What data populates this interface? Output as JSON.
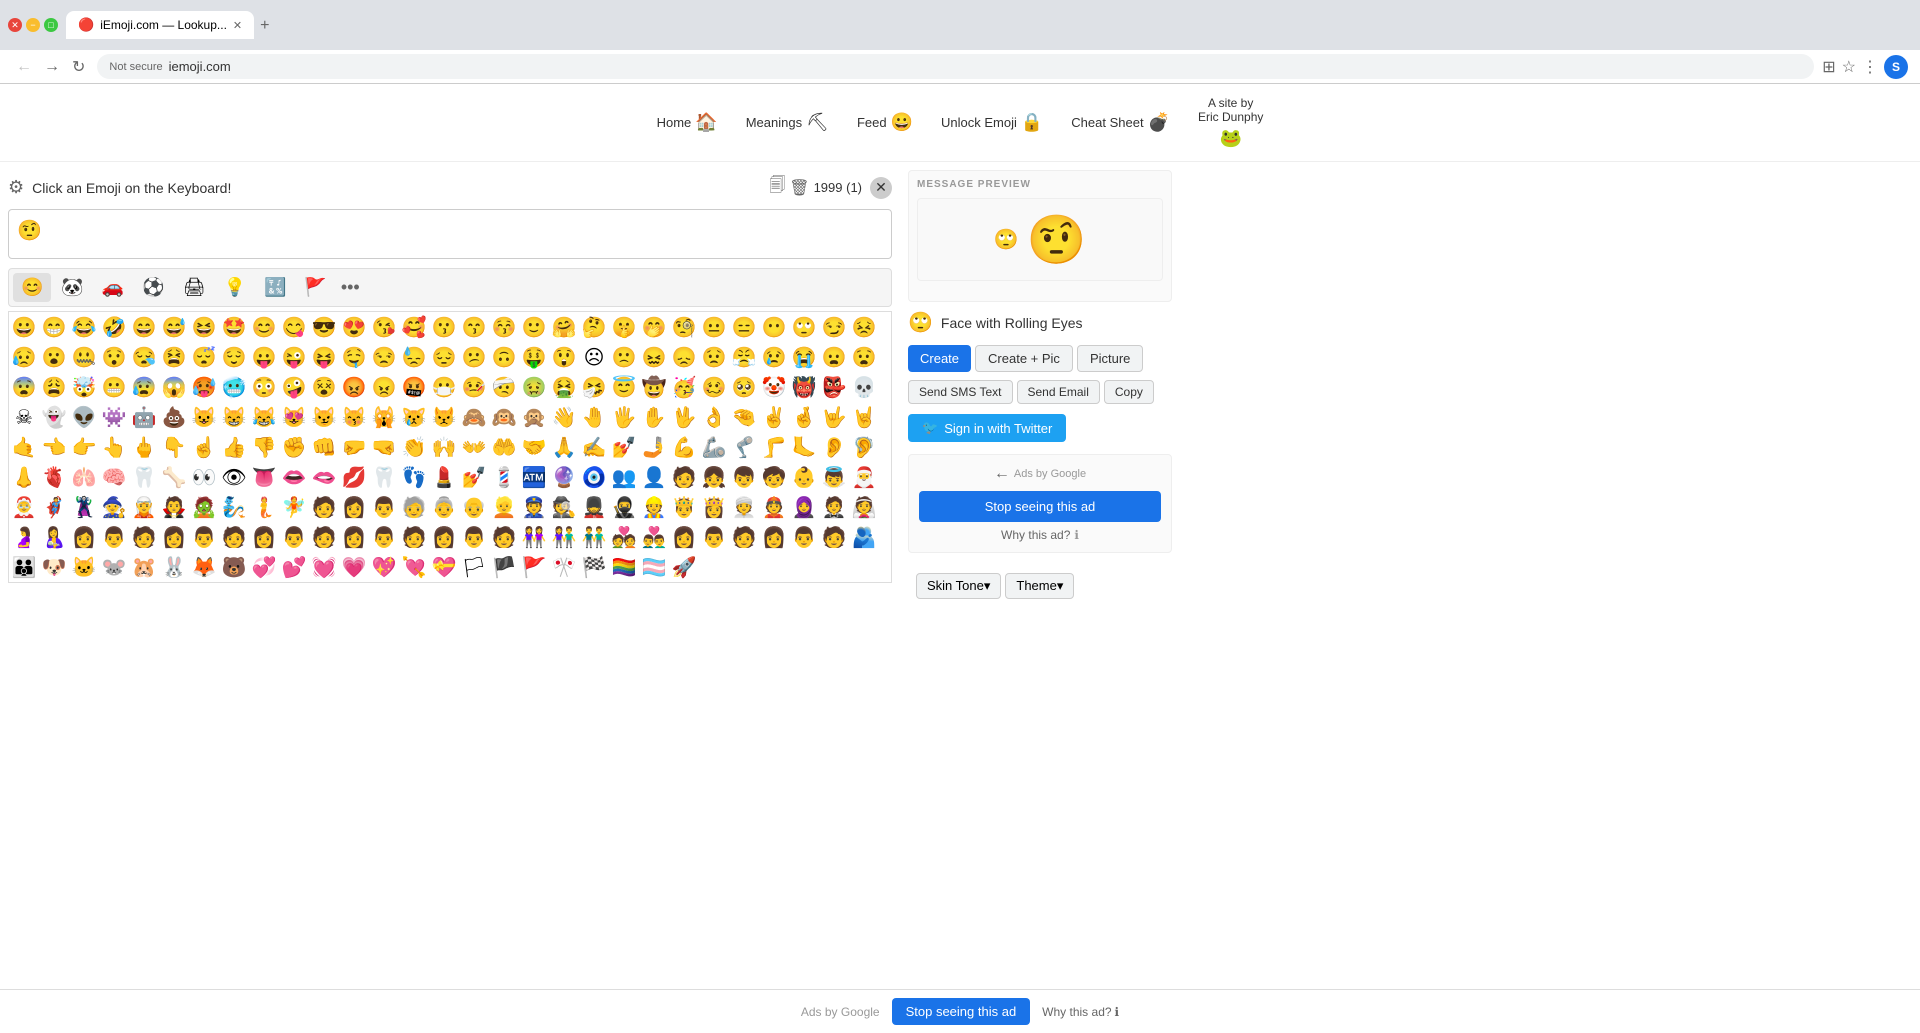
{
  "browser": {
    "tab_title": "iEmoji.com — Lookup...",
    "tab_favicon": "🔴",
    "url_security": "Not secure",
    "url": "iemoji.com",
    "new_tab_label": "+",
    "user_initial": "S"
  },
  "nav": {
    "items": [
      {
        "label": "Home",
        "emoji": "🏠"
      },
      {
        "label": "Meanings",
        "emoji": "⛏"
      },
      {
        "label": "Feed",
        "emoji": "😀"
      },
      {
        "label": "Unlock Emoji",
        "emoji": "🔒"
      },
      {
        "label": "Cheat Sheet",
        "emoji": "💣"
      }
    ],
    "site_by": "A site by\nEric Dunphy",
    "site_emoji": "🐸"
  },
  "keyboard": {
    "title": "Click an Emoji on the Keyboard!",
    "counter": "1999 (1)",
    "current_emoji": "🤨",
    "categories": [
      "😊",
      "🐼",
      "🚗",
      "⚽",
      "🖨",
      "💡",
      "🔣",
      "🚩",
      "•••"
    ]
  },
  "emojis": [
    "😀",
    "😁",
    "😂",
    "🤣",
    "😄",
    "😅",
    "😆",
    "🤩",
    "😊",
    "😋",
    "😎",
    "😍",
    "😘",
    "🥰",
    "😗",
    "😙",
    "😚",
    "🙂",
    "🤗",
    "🤔",
    "🤫",
    "🤭",
    "🧐",
    "😐",
    "😑",
    "😶",
    "🙄",
    "😏",
    "😣",
    "😥",
    "😮",
    "🤐",
    "😯",
    "😪",
    "😫",
    "😴",
    "😌",
    "😛",
    "😜",
    "😝",
    "🤤",
    "😒",
    "😓",
    "😔",
    "😕",
    "🙃",
    "🤑",
    "😲",
    "☹",
    "🙁",
    "😖",
    "😞",
    "😟",
    "😤",
    "😢",
    "😭",
    "😦",
    "😧",
    "😨",
    "😩",
    "🤯",
    "😬",
    "😰",
    "😱",
    "🥵",
    "🥶",
    "😳",
    "🤪",
    "😵",
    "😡",
    "😠",
    "🤬",
    "😷",
    "🤒",
    "🤕",
    "🤢",
    "🤮",
    "🤧",
    "😇",
    "🤠",
    "🥳",
    "🥴",
    "🥺",
    "🤡",
    "👹",
    "👺",
    "💀",
    "☠",
    "👻",
    "👽",
    "👾",
    "🤖",
    "💩",
    "😺",
    "😸",
    "😹",
    "😻",
    "😼",
    "😽",
    "🙀",
    "😿",
    "😾",
    "🙈",
    "🙉",
    "🙊",
    "👋",
    "🤚",
    "🖐",
    "✋",
    "🖖",
    "👌",
    "🤏",
    "✌",
    "🤞",
    "🤟",
    "🤘",
    "🤙",
    "👈",
    "👉",
    "👆",
    "🖕",
    "👇",
    "☝",
    "👍",
    "👎",
    "✊",
    "👊",
    "🤛",
    "🤜",
    "👏",
    "🙌",
    "👐",
    "🤲",
    "🤝",
    "🙏",
    "✍",
    "💅",
    "🤳",
    "💪",
    "🦾",
    "🦿",
    "🦵",
    "🦶",
    "👂",
    "🦻",
    "👃",
    "🫀",
    "🫁",
    "🧠",
    "🦷",
    "🦴",
    "👀",
    "👁",
    "👅",
    "👄",
    "🫦",
    "💋",
    "🦷",
    "👣",
    "💄",
    "💅",
    "💈",
    "🏧",
    "🔮",
    "🧿",
    "👥",
    "👤",
    "🧑",
    "👧",
    "👦",
    "🧒",
    "👶",
    "👼",
    "🎅",
    "🤶",
    "🦸",
    "🦹",
    "🧙",
    "🧝",
    "🧛",
    "🧟",
    "🧞",
    "🧜",
    "🧚",
    "🧑",
    "👩",
    "👨",
    "🧓",
    "👵",
    "👴",
    "👱",
    "👮",
    "🕵",
    "💂",
    "🥷",
    "👷",
    "🤴",
    "👸",
    "👳",
    "👲",
    "🧕",
    "🤵",
    "👰",
    "🤰",
    "🤱",
    "👩",
    "👨",
    "🧑",
    "👩",
    "👨",
    "🧑",
    "👩",
    "👨",
    "🧑",
    "👩",
    "👨",
    "🧑",
    "👩",
    "👨",
    "🧑",
    "👭",
    "👫",
    "👬",
    "💑",
    "👨‍❤️‍👨",
    "👩",
    "👨",
    "🧑",
    "👩",
    "👨",
    "🧑",
    "🫂",
    "👪",
    "🐶",
    "🐱",
    "🐭",
    "🐹",
    "🐰",
    "🦊",
    "🐻",
    "💞",
    "💕",
    "💓",
    "💗",
    "💖",
    "💘",
    "💝",
    "🏳",
    "🏴",
    "🚩",
    "🎌",
    "🏁",
    "🏳️‍🌈",
    "🏳️‍⚧️",
    "🚀"
  ],
  "right_panel": {
    "message_preview_label": "MESSAGE PREVIEW",
    "preview_emoji": "🤨",
    "emoji_icon": "🙄",
    "emoji_name": "Face with Rolling Eyes",
    "buttons": {
      "create": "Create",
      "create_plus_pic": "Create + Pic",
      "picture": "Picture",
      "send_sms": "Send SMS Text",
      "send_email": "Send Email",
      "copy": "Copy",
      "twitter_icon": "🐦",
      "twitter_label": "Sign in with Twitter"
    },
    "ads": {
      "label": "Ads by Google",
      "stop_btn": "Stop seeing this ad",
      "why_btn": "Why this ad?",
      "why_info_icon": "ℹ"
    },
    "skin_tone": "Skin Tone▾",
    "theme": "Theme▾"
  },
  "bottom_ad": {
    "label": "Ads by Google",
    "stop_btn": "Stop seeing this ad",
    "why_btn": "Why this ad?",
    "why_info_icon": "ℹ"
  }
}
